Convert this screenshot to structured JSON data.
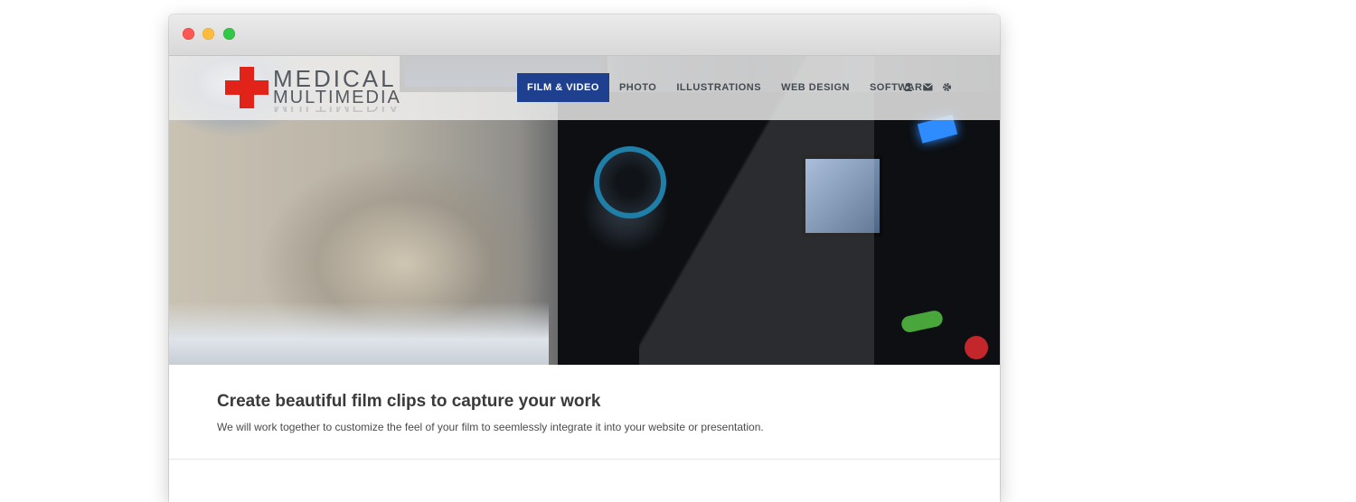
{
  "brand": {
    "line1": "MEDICAL",
    "line2": "MULTIMEDIA",
    "accent_color": "#e2231a"
  },
  "nav": {
    "items": [
      {
        "label": "FILM & VIDEO",
        "active": true
      },
      {
        "label": "PHOTO",
        "active": false
      },
      {
        "label": "ILLUSTRATIONS",
        "active": false
      },
      {
        "label": "WEB DESIGN",
        "active": false
      },
      {
        "label": "SOFTWARE",
        "active": false
      }
    ],
    "active_color": "#1f3f8f",
    "icons": [
      "user-icon",
      "mail-icon",
      "gear-icon"
    ]
  },
  "hero": {
    "image": "operating-room-camera-photo"
  },
  "content": {
    "headline": "Create beautiful film clips to capture your work",
    "description": "We will work together to customize the feel of your film to seemlessly integrate it into your website or presentation."
  },
  "window_controls": {
    "close_color": "#fc5753",
    "minimize_color": "#fdbc40",
    "maximize_color": "#33c748"
  }
}
